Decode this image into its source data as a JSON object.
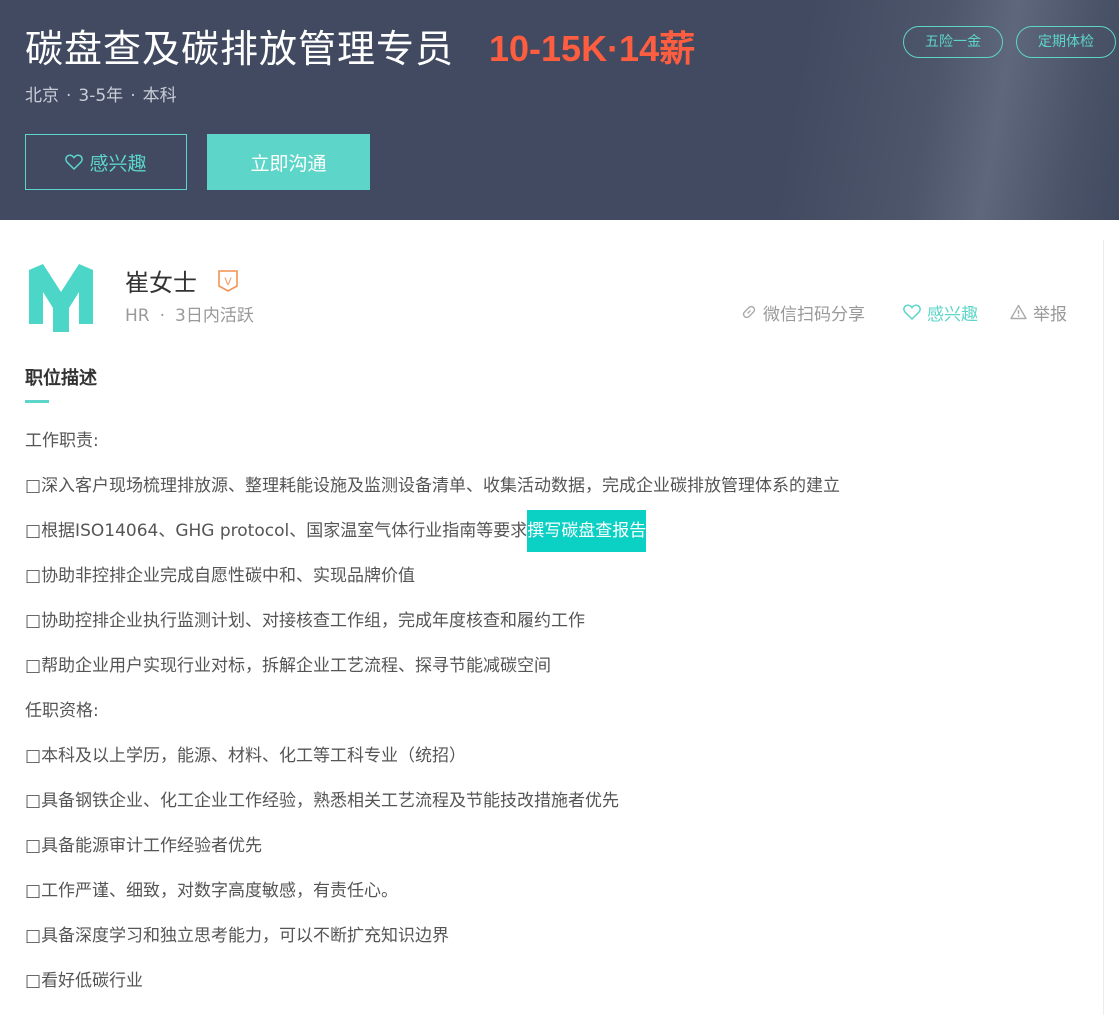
{
  "job": {
    "title": "碳盘查及碳排放管理专员",
    "salary": "10-15K·14薪",
    "city": "北京",
    "experience": "3-5年",
    "education": "本科",
    "sep": "·",
    "tags": [
      "五险一金",
      "定期体检"
    ],
    "interest_label": "感兴趣",
    "chat_label": "立即沟通"
  },
  "recruiter": {
    "name": "崔女士",
    "role": "HR",
    "dot": "·",
    "active": "3日内活跃",
    "verified_mark": "V"
  },
  "actions": {
    "share": "微信扫码分享",
    "interest": "感兴趣",
    "report": "举报"
  },
  "description": {
    "section_title": "职位描述",
    "duties_heading": "工作职责:",
    "duties": [
      "深入客户现场梳理排放源、整理耗能设施及监测设备清单、收集活动数据，完成企业碳排放管理体系的建立",
      "根据ISO14064、GHG protocol、国家温室气体行业指南等要求",
      "协助非控排企业完成自愿性碳中和、实现品牌价值",
      "协助控排企业执行监测计划、对接核查工作组，完成年度核查和履约工作",
      "帮助企业用户实现行业对标，拆解企业工艺流程、探寻节能减碳空间"
    ],
    "highlight": "撰写碳盘查报告",
    "qual_heading": "任职资格:",
    "qualifications": [
      "本科及以上学历，能源、材料、化工等工科专业（统招）",
      "具备钢铁企业、化工企业工作经验，熟悉相关工艺流程及节能技改措施者优先",
      "具备能源审计工作经验者优先",
      "工作严谨、细致，对数字高度敏感，有责任心。",
      "具备深度学习和独立思考能力，可以不断扩充知识边界",
      "看好低碳行业"
    ],
    "bullet": "□"
  },
  "colors": {
    "banner": "#414a60",
    "accent": "#5dd5c8",
    "salary": "#fe5d3f",
    "highlight": "#0bd0c4",
    "verified": "#f39253"
  }
}
